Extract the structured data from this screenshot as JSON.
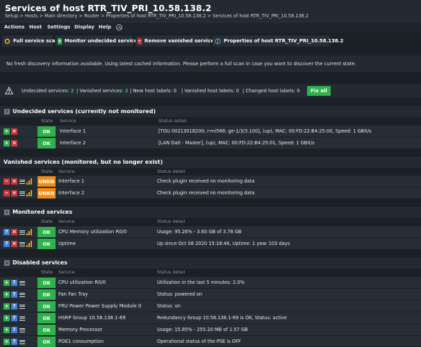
{
  "header": {
    "title": "Services of host RTR_TIV_PRI_10.58.138.2",
    "breadcrumb": "Setup > Hosts > Main directory > Router > Properties of host RTR_TIV_PRI_10.58.138.2 > Services of host RTR_TIV_PRI_10.58.138.2"
  },
  "menu": {
    "items": [
      "Actions",
      "Host",
      "Settings",
      "Display",
      "Help"
    ]
  },
  "toolbar": {
    "full_scan": "Full service scan",
    "monitor_undecided": "Monitor undecided services",
    "remove_vanished": "Remove vanished services",
    "host_properties": "Properties of host RTR_TIV_PRI_10.58.138.2"
  },
  "notice": "No fresh discovery information available. Using latest cached information. Please perform a full scan in case you want to discover the current state.",
  "summary": {
    "undecided_label": "Undecided services:",
    "undecided_value": "2",
    "vanished_label": "Vanished services:",
    "vanished_value": "2",
    "new_labels_label": "New host labels:",
    "new_labels_value": "0",
    "vanished_labels_label": "Vanished host labels:",
    "vanished_labels_value": "0",
    "changed_labels_label": "Changed host labels:",
    "changed_labels_value": "0",
    "fix_all": "Fix all"
  },
  "columns": {
    "state": "State",
    "service": "Service",
    "detail": "Status detail"
  },
  "sections": {
    "undecided": {
      "title": "Undecided services (currently not monitored)",
      "rows": [
        {
          "state": "OK",
          "service": "Interface 1",
          "detail": "[TGU 00213018200; r-mi568; ge-1/3/3.100], (up), MAC: 00:FD:22:B4:25:00, Speed: 1 GBit/s"
        },
        {
          "state": "OK",
          "service": "Interface 2",
          "detail": "[LAN Dati - Master], (up), MAC: 00:FD:22:B4:25:01, Speed: 1 GBit/s"
        }
      ]
    },
    "vanished": {
      "title": "Vanished services (monitored, but no longer exist)",
      "rows": [
        {
          "state": "UNKN",
          "service": "Interface 1",
          "detail": "Check plugin received no monitoring data"
        },
        {
          "state": "UNKN",
          "service": "Interface 2",
          "detail": "Check plugin received no monitoring data"
        }
      ]
    },
    "monitored": {
      "title": "Monitored services",
      "rows": [
        {
          "state": "OK",
          "service": "CPU Memory utilization R0/0",
          "detail": "Usage: 95.26% - 3.60 GB of 3.78 GB"
        },
        {
          "state": "OK",
          "service": "Uptime",
          "detail": "Up since Oct 08 2020 15:18:46, Uptime: 1 year 103 days"
        }
      ]
    },
    "disabled": {
      "title": "Disabled services",
      "rows": [
        {
          "state": "OK",
          "service": "CPU utilization R0/0",
          "detail": "Utilization in the last 5 minutes: 2.0%"
        },
        {
          "state": "OK",
          "service": "Fan Fan Tray",
          "detail": "Status: powered on"
        },
        {
          "state": "OK",
          "service": "FRU Power Power Supply Module 0",
          "detail": "Status: on"
        },
        {
          "state": "OK",
          "service": "HSRP Group 10.58.138.1-69",
          "detail": "Redundancy Group 10.58.138.1-69 is OK, Status: active"
        },
        {
          "state": "OK",
          "service": "Memory Processor",
          "detail": "Usage: 15.85% - 255.20 MB of 1.57 GB"
        },
        {
          "state": "OK",
          "service": "POE1 consumption",
          "detail": "Operational status of the PSE is OFF"
        }
      ]
    }
  },
  "colors": {
    "ok": "#2fb24c",
    "unknown": "#f08d1a",
    "critical": "#d0353a",
    "info": "#3f7fd6"
  }
}
